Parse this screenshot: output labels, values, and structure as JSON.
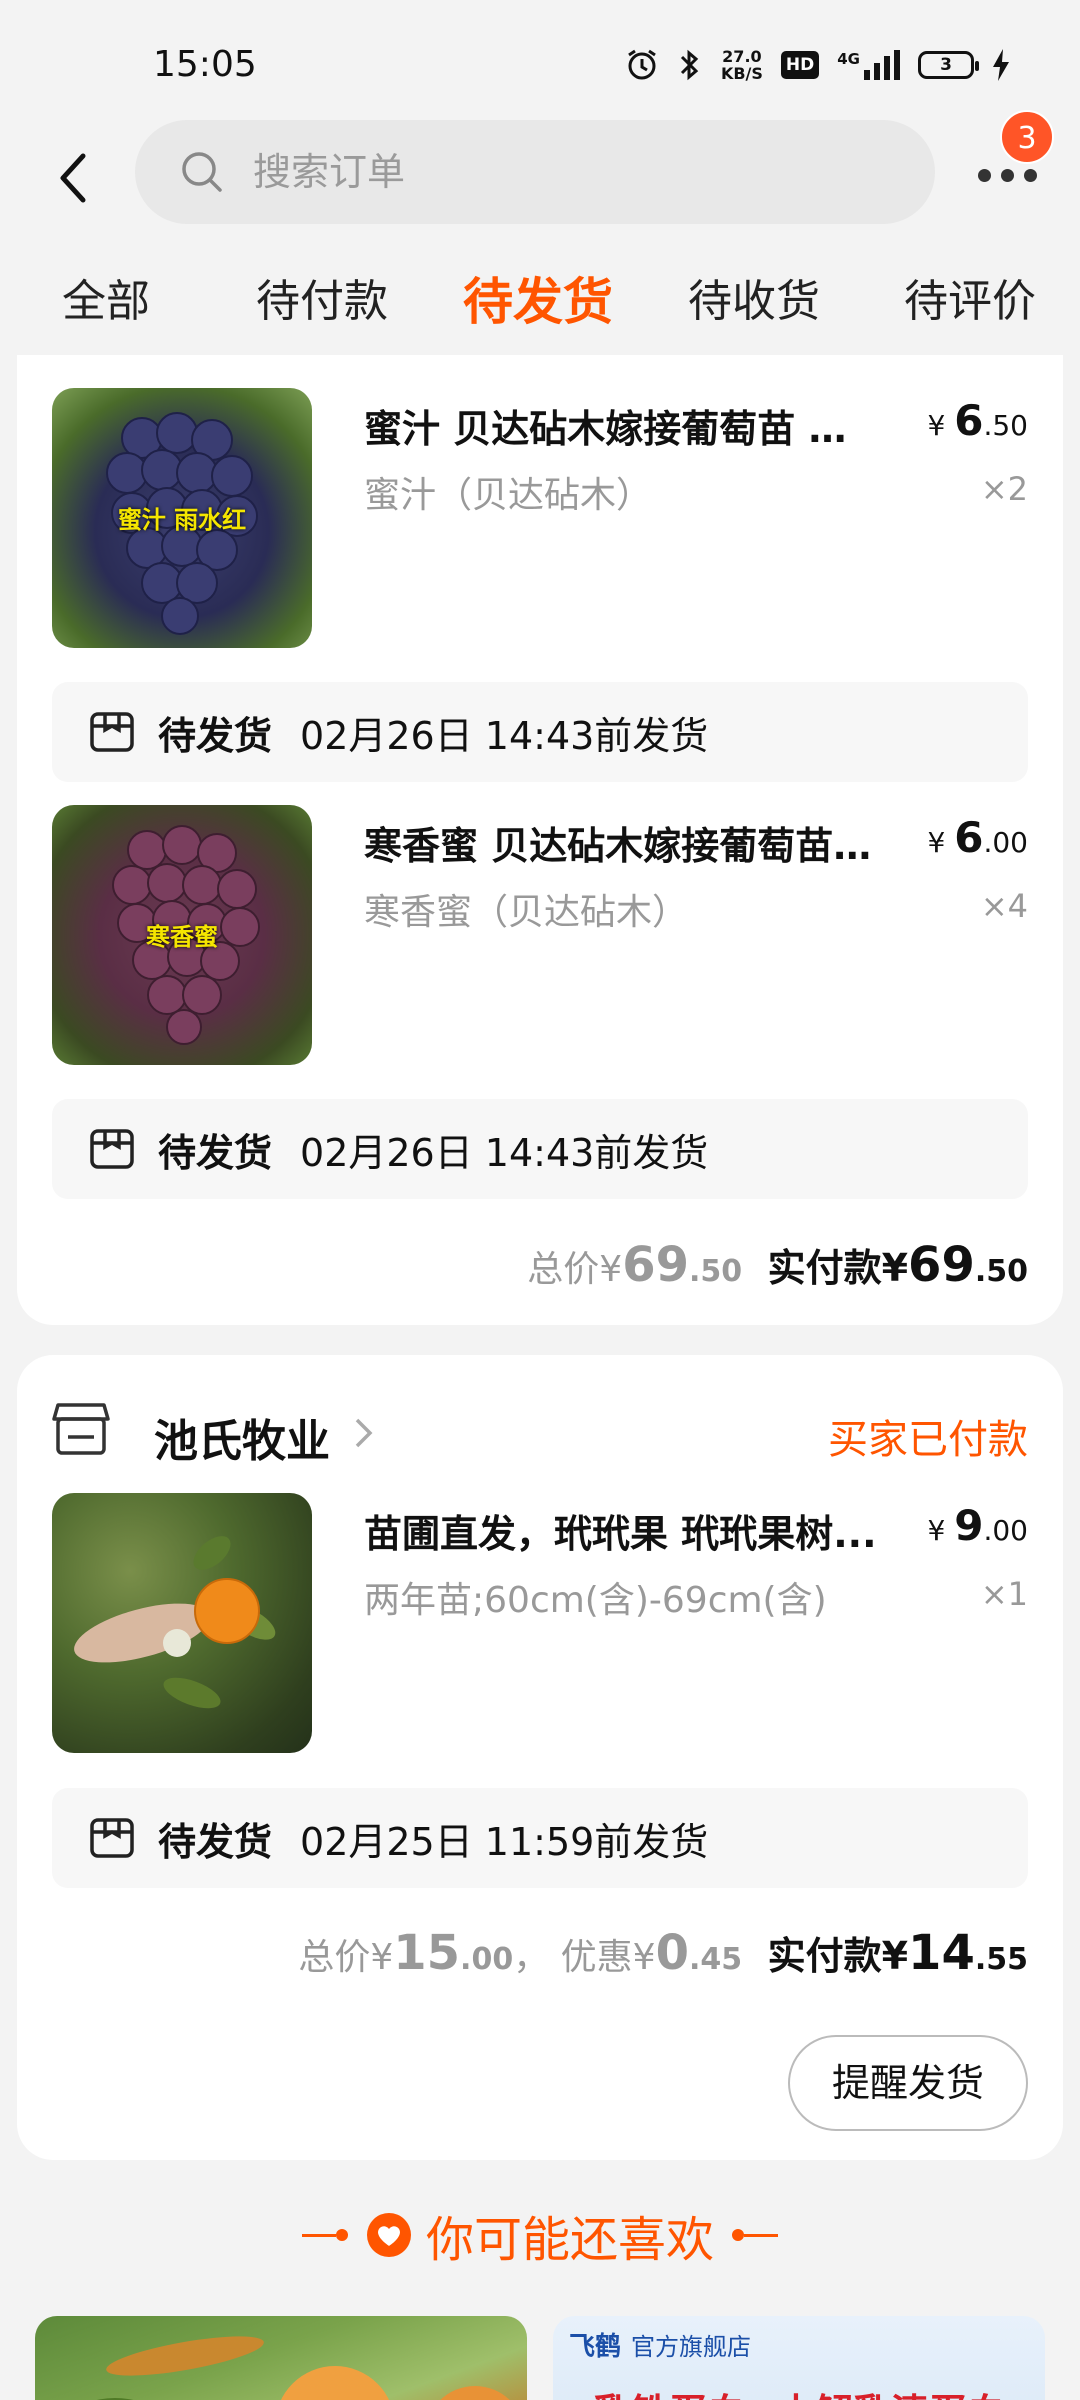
{
  "status_bar": {
    "time": "15:05",
    "net_speed_value": "27.0",
    "net_speed_unit": "KB/S",
    "hd": "HD",
    "network": "4G",
    "battery": "3"
  },
  "header": {
    "search_placeholder": "搜索订单",
    "badge_count": "3"
  },
  "tabs": [
    {
      "label": "全部",
      "active": false
    },
    {
      "label": "待付款",
      "active": false
    },
    {
      "label": "待发货",
      "active": true
    },
    {
      "label": "待收货",
      "active": false
    },
    {
      "label": "待评价",
      "active": false
    }
  ],
  "order1": {
    "items": [
      {
        "image_text": "蜜汁 雨水红",
        "title": "蜜汁 贝达砧木嫁接葡萄苗  宝...",
        "sku": "蜜汁（贝达砧木）",
        "price_currency": "¥",
        "price_int": "6",
        "price_dec": ".50",
        "qty": "×2",
        "ship_status": "待发货",
        "ship_time": "02月26日 14:43前发货"
      },
      {
        "image_text": "寒香蜜",
        "title": "寒香蜜 贝达砧木嫁接葡萄苗  ...",
        "sku": "寒香蜜（贝达砧木）",
        "price_currency": "¥",
        "price_int": "6",
        "price_dec": ".00",
        "qty": "×4",
        "ship_status": "待发货",
        "ship_time": "02月26日 14:43前发货"
      }
    ],
    "total_label": "总价¥",
    "total_int": "69",
    "total_dec": ".50",
    "paid_label": "实付款¥",
    "paid_int": "69",
    "paid_dec": ".50"
  },
  "order2": {
    "shop_name": "池氏牧业",
    "status": "买家已付款",
    "item": {
      "title": "苗圃直发，玳玳果 玳玳果树...",
      "sku": "两年苗;60cm(含)-69cm(含)",
      "price_currency": "¥",
      "price_int": "9",
      "price_dec": ".00",
      "qty": "×1",
      "ship_status": "待发货",
      "ship_time": "02月25日 11:59前发货"
    },
    "total_label": "总价¥",
    "total_int": "15",
    "total_dec": ".00",
    "separator": "，",
    "discount_label": "优惠¥",
    "discount_int": "0",
    "discount_dec": ".45",
    "paid_label": "实付款¥",
    "paid_int": "14",
    "paid_dec": ".55",
    "remind_button": "提醒发货"
  },
  "recommend": {
    "title": "你可能还喜欢",
    "right_brand": "飞鹤",
    "right_store": "官方旗舰店",
    "right_product": "乳铁蛋白+水解乳清蛋白"
  },
  "colors": {
    "accent": "#ff5500",
    "badge": "#ff5527",
    "muted": "#999999",
    "background": "#f3f3f3"
  }
}
